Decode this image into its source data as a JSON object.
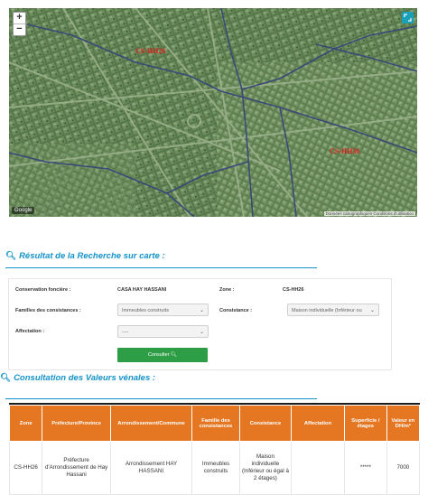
{
  "map": {
    "zoom_in": "+",
    "zoom_out": "−",
    "zones": [
      "CS-HH26",
      "CS-HH36"
    ],
    "logo": "Google",
    "attribution": "Données cartographiques  Conditions d'utilisation",
    "colors": {
      "zone_label": "#e02020",
      "fullscreen": "#1aa0b8"
    }
  },
  "result": {
    "title": "Résultat de la Recherche sur carte :",
    "conservation_label": "Conservation foncière :",
    "conservation_value": "CASA HAY HASSANI",
    "zone_label": "Zone :",
    "zone_value": "CS-HH26",
    "familles_label": "Familles des consistances :",
    "familles_value": "Immeubles construits",
    "consistance_label": "Consistance :",
    "consistance_value": "Maison individuelle (Inférieur ou",
    "affectation_label": "Affectation :",
    "affectation_value": "----",
    "button": "Consulter"
  },
  "consult": {
    "title": "Consultation des Valeurs vénales :",
    "headers": [
      "Zone",
      "Préfecture/Province",
      "Arrondissement/Commune",
      "Famille des consistances",
      "Consistance",
      "Affectation",
      "Superficie / étages",
      "Valeur en DH/m²"
    ],
    "row": [
      "CS-HH26",
      "Préfecture d'Arrondissement de Hay Hassani",
      "Arrondissement HAY HASSANI",
      "Immeubles construits",
      "Maison individuelle (Inférieur ou égal à 2 étages)",
      "",
      "*****",
      "7000"
    ],
    "colors": {
      "header_bg": "#e57722",
      "title": "#1493c8",
      "button": "#2e9e46"
    }
  }
}
